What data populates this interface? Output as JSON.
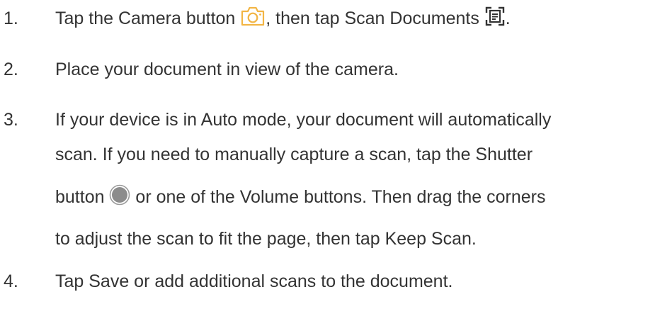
{
  "steps": [
    {
      "number": "1.",
      "text_before_camera": "Tap the Camera button",
      "text_between": ", then tap Scan Documents",
      "text_end": "."
    },
    {
      "number": "2.",
      "text": "Place your document in view of the camera."
    },
    {
      "number": "3.",
      "line1": "If your device is in Auto mode, your document will automatically",
      "line2": "scan. If you need to manually capture a scan, tap the Shutter",
      "line3_before_icon": "button",
      "line3_after_icon": "or one of the Volume buttons. Then drag the corners",
      "line4": "to adjust the scan to fit the page, then tap Keep Scan."
    },
    {
      "number": "4.",
      "text": "Tap Save or add additional scans to the document."
    }
  ],
  "icons": {
    "camera": "camera-icon",
    "scan_documents": "scan-documents-icon",
    "shutter": "shutter-button-icon"
  },
  "colors": {
    "text": "#333333",
    "camera_icon": "#F2B544",
    "shutter_outer": "#9A9A9A",
    "shutter_inner": "#8C8C8C"
  }
}
